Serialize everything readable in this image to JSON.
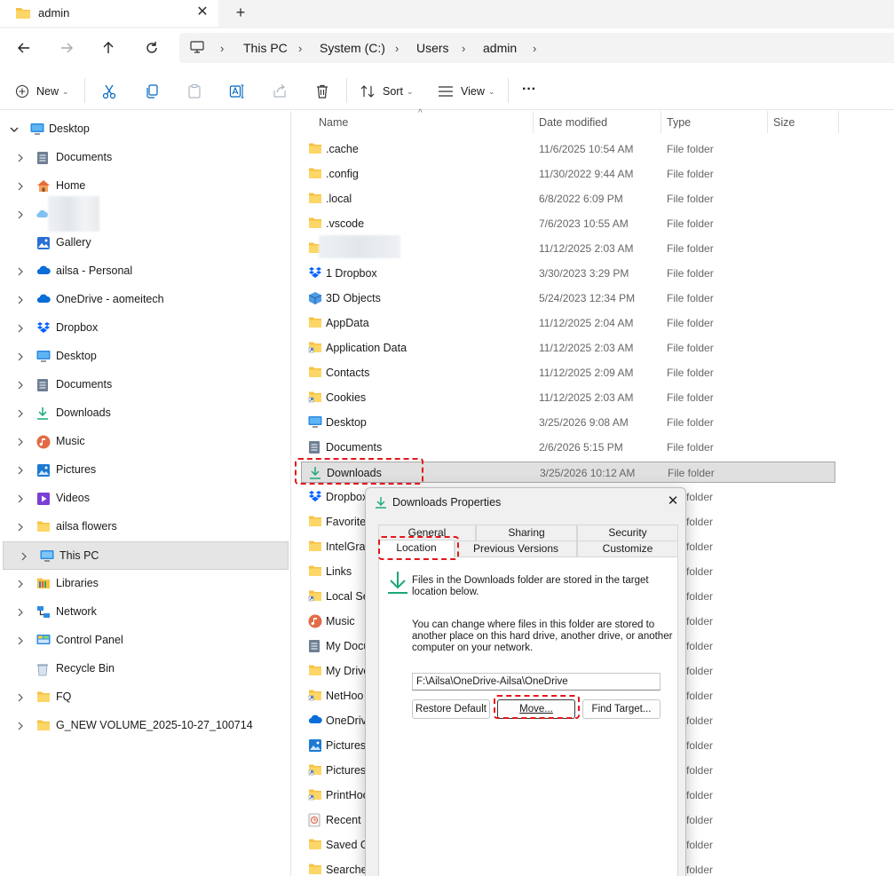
{
  "window": {
    "tab_title": "admin",
    "tab_close": "✕",
    "new_tab": "+"
  },
  "address": {
    "crumbs": [
      "This PC",
      "System (C:)",
      "Users",
      "admin"
    ],
    "sep": "›"
  },
  "toolbar": {
    "new_label": "New",
    "sort_label": "Sort",
    "view_label": "View",
    "more_label": "···"
  },
  "sidebar": {
    "items": [
      {
        "label": "Desktop",
        "icon": "desktop-icon"
      },
      {
        "label": "Documents",
        "icon": "documents-icon"
      },
      {
        "label": "Home",
        "icon": "home-icon"
      },
      {
        "label": "",
        "icon": "blurred-item"
      },
      {
        "label": "Gallery",
        "icon": "gallery-icon"
      },
      {
        "label": "ailsa - Personal",
        "icon": "onedrive-icon"
      },
      {
        "label": "OneDrive - aomeitech",
        "icon": "onedrive-icon"
      },
      {
        "label": "Dropbox",
        "icon": "dropbox-icon"
      },
      {
        "label": "Desktop",
        "icon": "desktop-icon"
      },
      {
        "label": "Documents",
        "icon": "documents-icon"
      },
      {
        "label": "Downloads",
        "icon": "downloads-icon"
      },
      {
        "label": "Music",
        "icon": "music-icon"
      },
      {
        "label": "Pictures",
        "icon": "pictures-icon"
      },
      {
        "label": "Videos",
        "icon": "videos-icon"
      },
      {
        "label": "ailsa flowers",
        "icon": "folder-icon"
      },
      {
        "label": "This PC",
        "icon": "this-pc-icon"
      },
      {
        "label": "Libraries",
        "icon": "libraries-icon"
      },
      {
        "label": "Network",
        "icon": "network-icon"
      },
      {
        "label": "Control Panel",
        "icon": "control-panel-icon"
      },
      {
        "label": "Recycle Bin",
        "icon": "recycle-bin-icon"
      },
      {
        "label": "FQ",
        "icon": "folder-icon"
      },
      {
        "label": "G_NEW VOLUME_2025-10-27_100714",
        "icon": "folder-icon"
      }
    ]
  },
  "list": {
    "headers": {
      "name": "Name",
      "date": "Date modified",
      "type": "Type",
      "size": "Size"
    },
    "rows": [
      {
        "name": ".cache",
        "date": "11/6/2025 10:54 AM",
        "type": "File folder"
      },
      {
        "name": ".config",
        "date": "11/30/2022 9:44 AM",
        "type": "File folder"
      },
      {
        "name": ".local",
        "date": "6/8/2022 6:09 PM",
        "type": "File folder"
      },
      {
        "name": ".vscode",
        "date": "7/6/2023 10:55 AM",
        "type": "File folder"
      },
      {
        "name": "",
        "date": "11/12/2025 2:03 AM",
        "type": "File folder"
      },
      {
        "name": "1 Dropbox",
        "date": "3/30/2023 3:29 PM",
        "type": "File folder"
      },
      {
        "name": "3D Objects",
        "date": "5/24/2023 12:34 PM",
        "type": "File folder"
      },
      {
        "name": "AppData",
        "date": "11/12/2025 2:04 AM",
        "type": "File folder"
      },
      {
        "name": "Application Data",
        "date": "11/12/2025 2:03 AM",
        "type": "File folder"
      },
      {
        "name": "Contacts",
        "date": "11/12/2025 2:09 AM",
        "type": "File folder"
      },
      {
        "name": "Cookies",
        "date": "11/12/2025 2:03 AM",
        "type": "File folder"
      },
      {
        "name": "Desktop",
        "date": "3/25/2026 9:08 AM",
        "type": "File folder"
      },
      {
        "name": "Documents",
        "date": "2/6/2026 5:15 PM",
        "type": "File folder"
      },
      {
        "name": "Downloads",
        "date": "3/25/2026 10:12 AM",
        "type": "File folder"
      },
      {
        "name": "Dropbox",
        "date": "",
        "type": "folder"
      },
      {
        "name": "Favorite",
        "date": "",
        "type": "folder"
      },
      {
        "name": "IntelGrap",
        "date": "",
        "type": "folder"
      },
      {
        "name": "Links",
        "date": "",
        "type": "folder"
      },
      {
        "name": "Local Set",
        "date": "",
        "type": "folder"
      },
      {
        "name": "Music",
        "date": "",
        "type": "folder"
      },
      {
        "name": "My Docu",
        "date": "",
        "type": "folder"
      },
      {
        "name": "My Drive",
        "date": "",
        "type": "folder"
      },
      {
        "name": "NetHoo",
        "date": "",
        "type": "folder"
      },
      {
        "name": "OneDriv",
        "date": "",
        "type": "folder"
      },
      {
        "name": "Pictures",
        "date": "",
        "type": "folder"
      },
      {
        "name": "Pictures",
        "date": "",
        "type": "folder"
      },
      {
        "name": "PrintHoo",
        "date": "",
        "type": "folder"
      },
      {
        "name": "Recent",
        "date": "",
        "type": "folder"
      },
      {
        "name": "Saved Ga",
        "date": "",
        "type": "folder"
      },
      {
        "name": "Searches",
        "date": "",
        "type": "folder"
      }
    ]
  },
  "dialog": {
    "title": "Downloads Properties",
    "close": "✕",
    "tabs_top": [
      "General",
      "Sharing",
      "Security"
    ],
    "tabs_bottom": [
      "Location",
      "Previous Versions",
      "Customize"
    ],
    "info_line1": "Files in the Downloads folder are stored in the target",
    "info_line2": "location below.",
    "desc_line1": "You can change where files in this folder are stored to",
    "desc_line2": "another place on this hard drive, another drive, or another",
    "desc_line3": "computer on your network.",
    "path": "F:\\Ailsa\\OneDrive-Ailsa\\OneDrive",
    "restore_label": "Restore Default",
    "move_label": "Move...",
    "find_label": "Find Target..."
  },
  "colors": {
    "highlight": "#e4161b",
    "folder": "#f6c244",
    "accent": "#0067c0"
  }
}
